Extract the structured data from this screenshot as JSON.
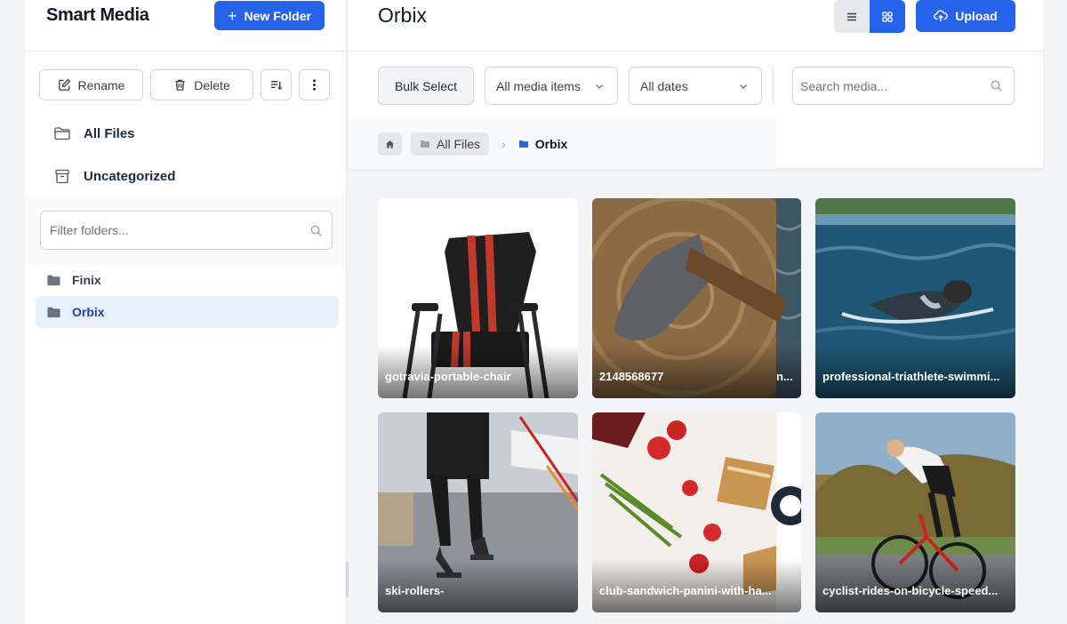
{
  "sidebar": {
    "app_title": "Smart Media",
    "new_folder_label": "New Folder",
    "actions": {
      "rename": "Rename",
      "delete": "Delete"
    },
    "nav": [
      {
        "label": "All Files",
        "icon": "folder-outline-icon"
      },
      {
        "label": "Uncategorized",
        "icon": "archive-icon"
      }
    ],
    "filter_placeholder": "Filter folders...",
    "folders": [
      {
        "label": "Finix",
        "active": false
      },
      {
        "label": "Orbix",
        "active": true
      }
    ]
  },
  "main": {
    "title": "Orbix",
    "upload_label": "Upload",
    "bulk_select_label": "Bulk Select",
    "type_filter": "All media items",
    "date_filter": "All dates",
    "search_placeholder": "Search media...",
    "breadcrumb": {
      "root": "All Files",
      "current": "Orbix"
    },
    "items": [
      {
        "name": "gotravia-portable-chair"
      },
      {
        "name": "2148568677",
        "overflow_tail": "n..."
      },
      {
        "name": "professional-triathlete-swimmi..."
      },
      {
        "name": "ski-rollers-"
      },
      {
        "name": "club-sandwich-panini-with-ha..."
      },
      {
        "name": "cyclist-rides-on-bicycle-speed..."
      }
    ]
  },
  "colors": {
    "accent": "#2563eb",
    "active_folder_bg": "#e8f0fc"
  }
}
